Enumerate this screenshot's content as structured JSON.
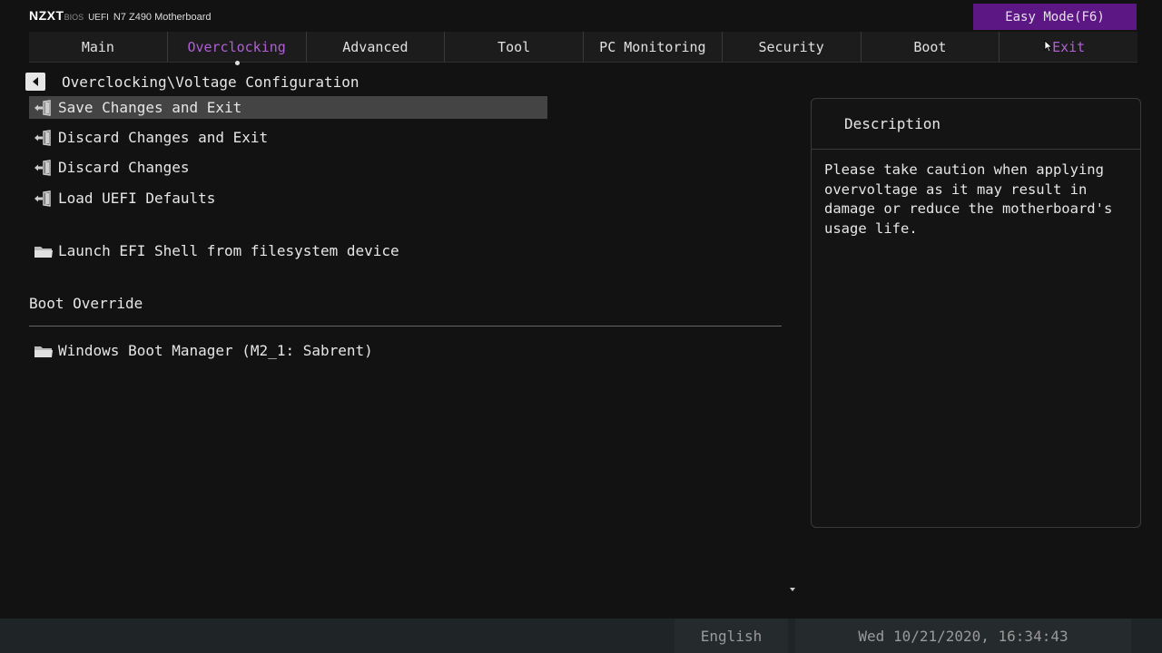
{
  "brand": {
    "logo": "NZXT",
    "bios": "BIOS",
    "uefi": "UEFI",
    "model": "N7 Z490 Motherboard"
  },
  "easy_mode_label": "Easy Mode(F6)",
  "tabs": [
    {
      "label": "Main",
      "state": "normal"
    },
    {
      "label": "Overclocking",
      "state": "active"
    },
    {
      "label": "Advanced",
      "state": "normal"
    },
    {
      "label": "Tool",
      "state": "normal"
    },
    {
      "label": "PC Monitoring",
      "state": "normal"
    },
    {
      "label": "Security",
      "state": "normal"
    },
    {
      "label": "Boot",
      "state": "normal"
    },
    {
      "label": "Exit",
      "state": "hover"
    }
  ],
  "breadcrumb": "Overclocking\\Voltage Configuration",
  "menu": {
    "items": [
      {
        "label": "Save Changes and Exit",
        "icon": "exit-door-icon",
        "selected": true
      },
      {
        "label": "Discard Changes and Exit",
        "icon": "exit-door-icon"
      },
      {
        "label": "Discard Changes",
        "icon": "exit-door-icon"
      },
      {
        "label": "Load UEFI Defaults",
        "icon": "exit-door-icon"
      },
      {
        "label": "Launch EFI Shell from filesystem device",
        "icon": "folder-icon"
      }
    ],
    "boot_override_title": "Boot Override",
    "boot_items": [
      {
        "label": "Windows Boot Manager (M2_1: Sabrent)",
        "icon": "folder-icon"
      }
    ]
  },
  "description": {
    "title": "Description",
    "text": "Please take caution when applying\novervoltage as it may result in\ndamage or reduce the motherboard's\nusage life."
  },
  "footer": {
    "language": "English",
    "datetime": "Wed 10/21/2020, 16:34:43"
  },
  "colors": {
    "accent": "#b05fd6",
    "easy_mode_bg": "#5d1785",
    "selected_row": "#444444"
  }
}
